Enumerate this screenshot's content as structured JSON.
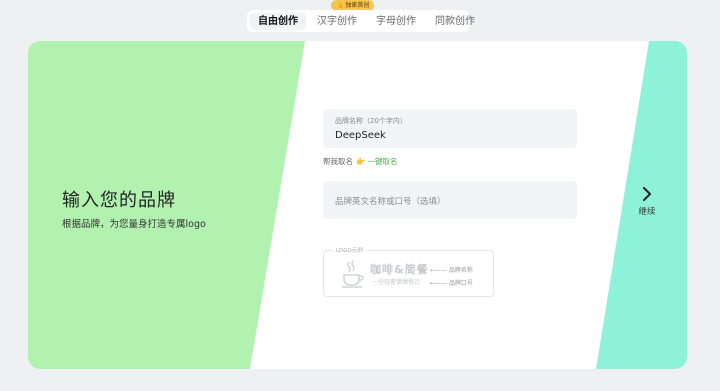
{
  "tabs": {
    "badge": "👍 独家首创",
    "items": [
      {
        "label": "自由创作",
        "active": true
      },
      {
        "label": "汉字创作",
        "active": false
      },
      {
        "label": "字母创作",
        "active": false
      },
      {
        "label": "同款创作",
        "active": false
      }
    ]
  },
  "hero": {
    "title": "输入您的品牌",
    "subtitle": "根据品牌，为您量身打造专属logo"
  },
  "form": {
    "brand_label": "品牌名称（20个字内）",
    "brand_value": "DeepSeek",
    "helper_text": "帮我取名",
    "helper_link": "一键取名",
    "slogan_placeholder": "品牌英文名称或口号（选填）"
  },
  "sample": {
    "label": "LOGO示例",
    "brand_name": "咖啡&简餐",
    "slogan": "一份轻奢慵懒餐饮",
    "arrow_name": "←—— 品牌名称",
    "arrow_slogan": "←—— 品牌口号"
  },
  "continue_label": "继续",
  "colors": {
    "left_panel": "#b2f2b0",
    "right_panel": "#8ef2d8",
    "link": "#4cae4c"
  }
}
